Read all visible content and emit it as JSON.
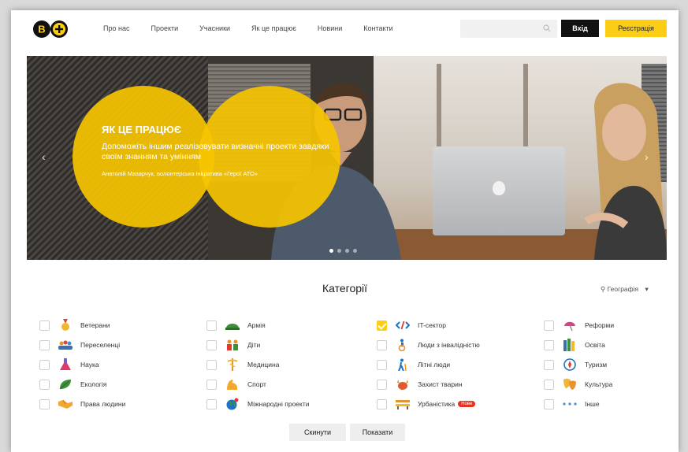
{
  "header": {
    "logo_text": "B+",
    "nav": [
      "Про нас",
      "Проекти",
      "Учасники",
      "Як це працює",
      "Новини",
      "Контакти"
    ],
    "search_placeholder": "",
    "login_label": "Вхід",
    "register_label": "Реєстрація"
  },
  "hero": {
    "title": "Як це працює",
    "subtitle": "Допоможіть іншим реалізовувати визначні проекти завдяки своїм знанням та умінням",
    "author": "Анатолій Мазарчук, волонтерська ініціатива «Герої АТО»",
    "slides_count": 4,
    "active_slide": 1
  },
  "categories": {
    "title": "Категорії",
    "geo_label": "Географія",
    "items": [
      {
        "label": "Ветерани",
        "icon": "medal-icon",
        "checked": false
      },
      {
        "label": "Армія",
        "icon": "helmet-icon",
        "checked": false
      },
      {
        "label": "IT-сектор",
        "icon": "code-icon",
        "checked": true
      },
      {
        "label": "Реформи",
        "icon": "umbrella-icon",
        "checked": false
      },
      {
        "label": "Переселенці",
        "icon": "people-icon",
        "checked": false
      },
      {
        "label": "Діти",
        "icon": "children-icon",
        "checked": false
      },
      {
        "label": "Люди з інвалідністю",
        "icon": "wheelchair-icon",
        "checked": false
      },
      {
        "label": "Освіта",
        "icon": "books-icon",
        "checked": false
      },
      {
        "label": "Наука",
        "icon": "flask-icon",
        "checked": false
      },
      {
        "label": "Медицина",
        "icon": "caduceus-icon",
        "checked": false
      },
      {
        "label": "Літні люди",
        "icon": "elderly-icon",
        "checked": false
      },
      {
        "label": "Туризм",
        "icon": "compass-icon",
        "checked": false
      },
      {
        "label": "Екологія",
        "icon": "leaf-icon",
        "checked": false
      },
      {
        "label": "Спорт",
        "icon": "muscle-icon",
        "checked": false
      },
      {
        "label": "Захист тварин",
        "icon": "animal-icon",
        "checked": false
      },
      {
        "label": "Культура",
        "icon": "masks-icon",
        "checked": false
      },
      {
        "label": "Права людини",
        "icon": "handshake-icon",
        "checked": false
      },
      {
        "label": "Міжнародні проекти",
        "icon": "globe-icon",
        "checked": false
      },
      {
        "label": "Урбаністика",
        "icon": "bench-icon",
        "checked": false,
        "badge": "Нове"
      },
      {
        "label": "Інше",
        "icon": "dots-icon",
        "checked": false
      }
    ],
    "reset_label": "Скинути",
    "show_label": "Показати"
  },
  "colors": {
    "accent": "#fccd15",
    "circle": "#f6c400",
    "badge": "#e8321f"
  }
}
